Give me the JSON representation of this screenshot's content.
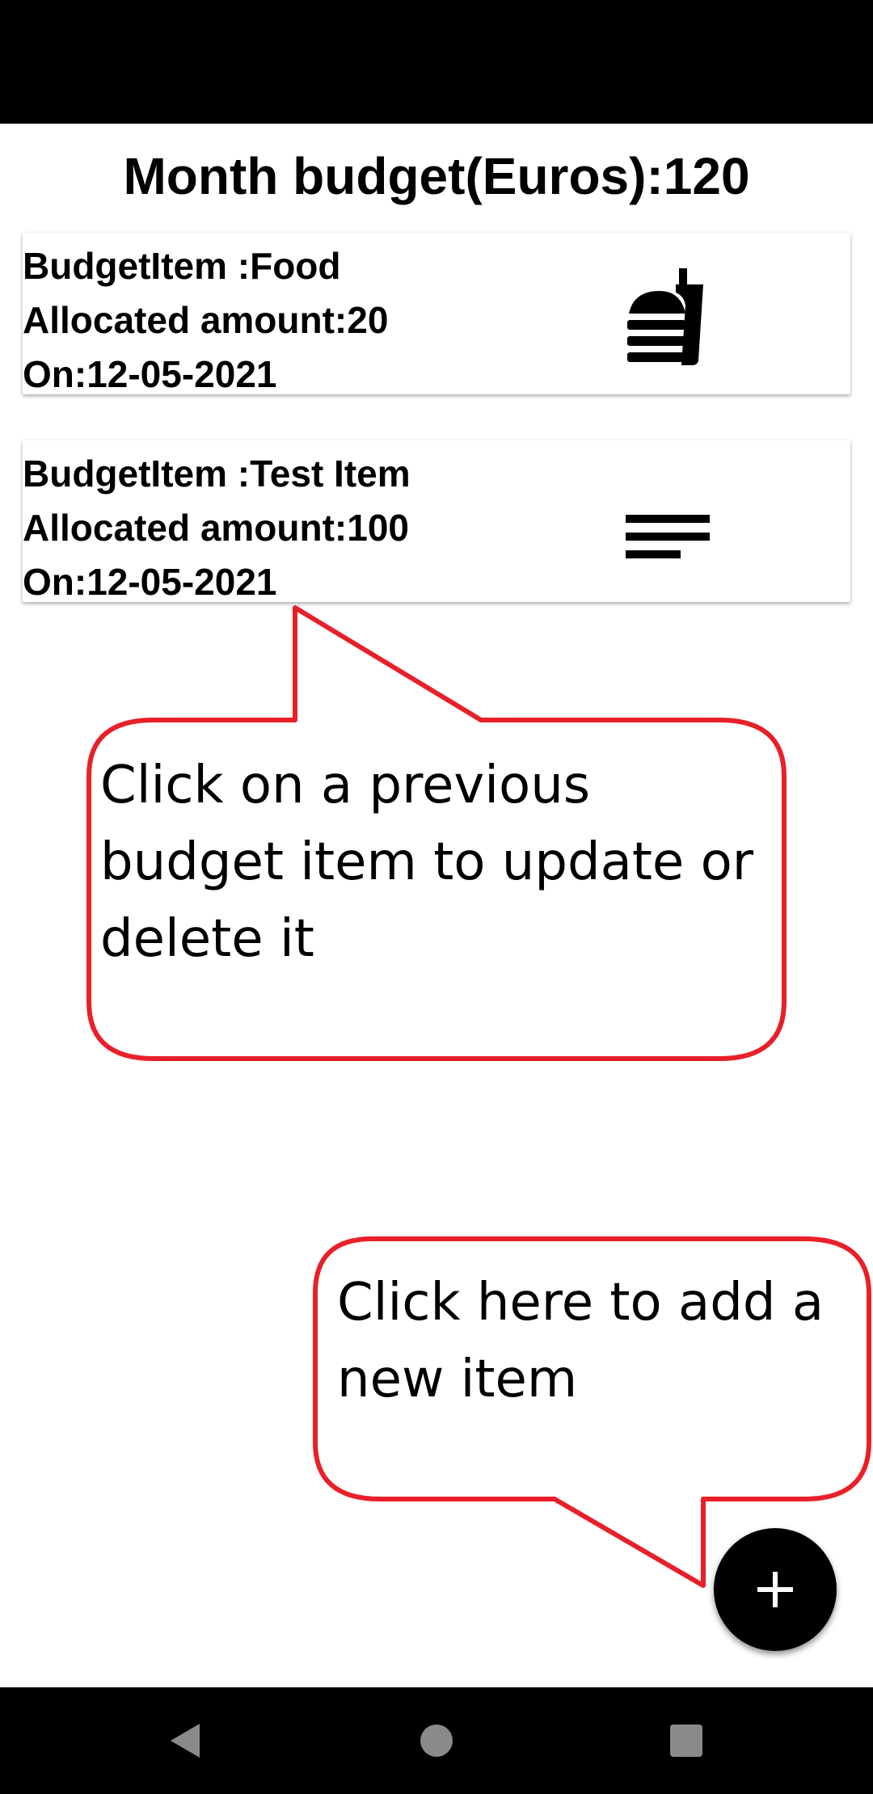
{
  "header": {
    "title": "Month budget(Euros):120"
  },
  "budget_items": [
    {
      "name_line": "BudgetItem :Food",
      "amount_line": "Allocated amount:20",
      "date_line": "On:12-05-2021",
      "icon": "fastfood-icon"
    },
    {
      "name_line": "BudgetItem :Test Item",
      "amount_line": "Allocated amount:100",
      "date_line": "On:12-05-2021",
      "icon": "notes-icon"
    }
  ],
  "tutorial": {
    "list_hint": "Click on a previous budget item to update or delete it",
    "add_hint": "Click here to add a new item"
  },
  "fab": {
    "icon": "plus-icon"
  },
  "nav": {
    "icons": [
      "back-icon",
      "home-icon",
      "recents-icon"
    ]
  },
  "colors": {
    "callout_border": "#e8202a",
    "fab": "#000000",
    "bars": "#000000"
  }
}
